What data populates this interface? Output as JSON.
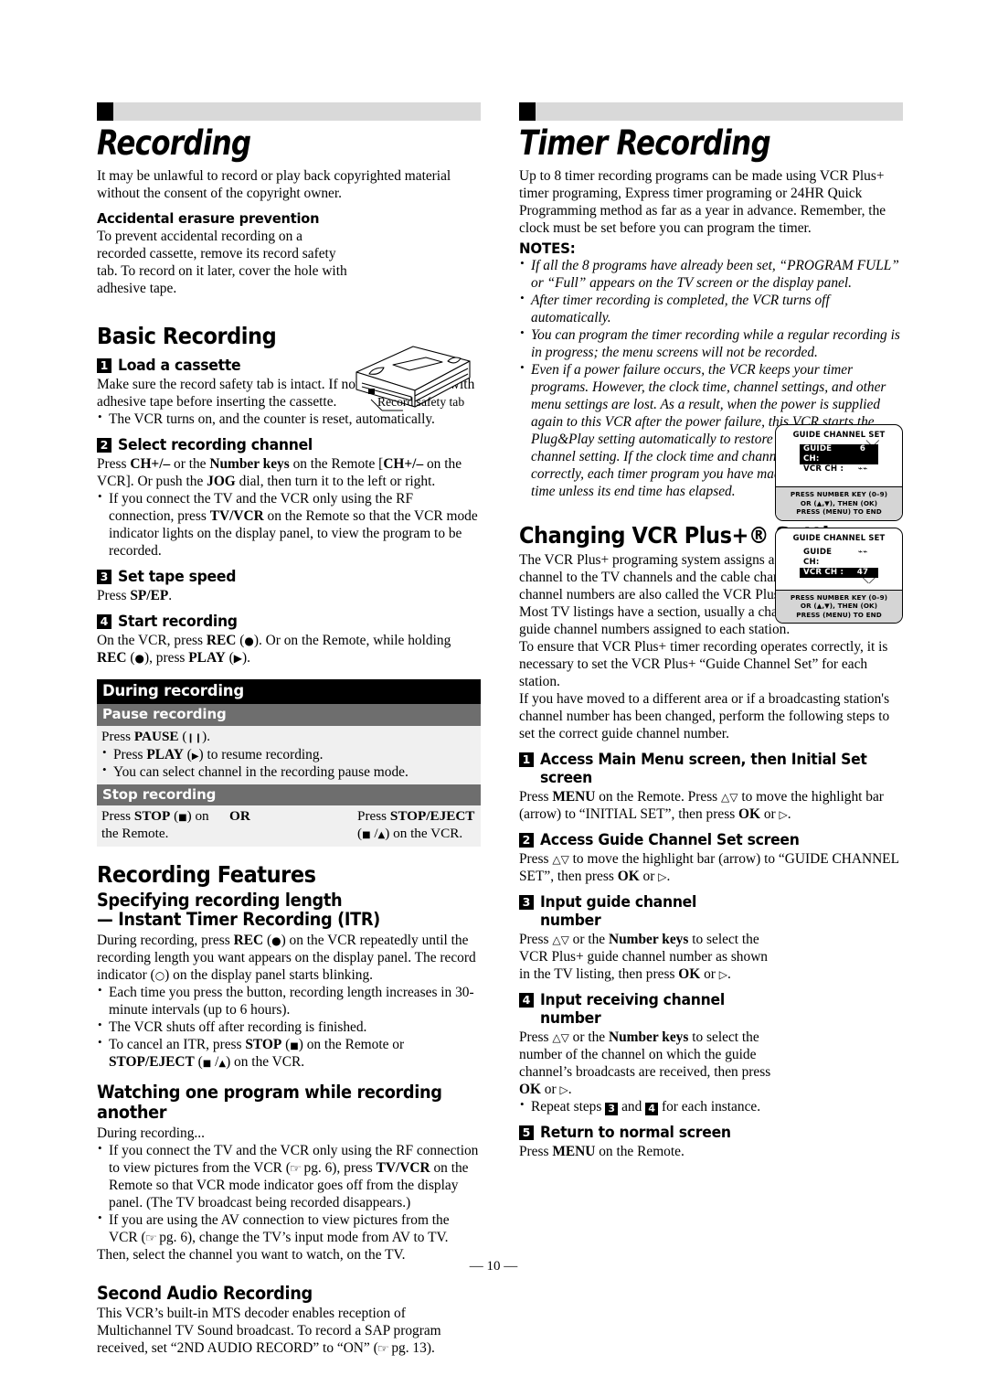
{
  "page": {
    "number": "— 10 —"
  },
  "left": {
    "chapter_title": "Recording",
    "intro": "It may be unlawful to record or play back copyrighted material without the consent of the copyright owner.",
    "accidental": {
      "heading": "Accidental erasure prevention",
      "body": "To prevent accidental recording on a recorded cassette, remove its record safety tab. To record on it later, cover the hole with adhesive tape.",
      "illustration_caption": "Record safety tab"
    },
    "basic_recording": {
      "heading": "Basic Recording",
      "steps": [
        {
          "num": "1",
          "title": "Load a cassette",
          "body": "Make sure the record safety tab is intact. If not, cover the hole with adhesive tape before inserting the cassette.",
          "bullets": [
            "The VCR turns on, and the counter is reset, automatically."
          ]
        },
        {
          "num": "2",
          "title": "Select recording channel",
          "body_pre": "Press ",
          "bullets": [
            "If you connect the TV and the VCR only using the RF connection, press TV/VCR on the Remote so that the VCR mode indicator lights on the display panel, to view the program to be recorded."
          ]
        },
        {
          "num": "3",
          "title": "Set tape speed",
          "body": "Press SP/EP."
        },
        {
          "num": "4",
          "title": "Start recording",
          "body": "On the VCR, press REC (●). Or on the Remote, while holding REC (●), press PLAY (▶)."
        }
      ]
    },
    "during_recording_table": {
      "header": "During recording",
      "pause_header": "Pause recording",
      "pause_line1": "Press PAUSE (❙❙).",
      "pause_bullets": [
        "Press PLAY (▶) to resume recording.",
        "You can select channel in the recording pause mode."
      ],
      "stop_header": "Stop recording",
      "stop_left": "Press STOP (■) on the Remote.",
      "or_label": "OR",
      "stop_right": "Press STOP/EJECT (■ / ▲) on the VCR."
    },
    "recording_features": {
      "heading": "Recording Features",
      "itr": {
        "heading_line1": "Specifying recording length",
        "heading_line2": "— Instant Timer Recording (ITR)",
        "body": "During recording, press REC (●) on the VCR repeatedly until the recording length you want appears on the display panel. The record indicator (○) on the display panel starts blinking.",
        "bullets": [
          "Each time you press the button, recording length increases in 30-minute intervals (up to 6 hours).",
          "The VCR shuts off after recording is finished.",
          "To cancel an ITR, press STOP (■) on the Remote or STOP/EJECT (■ / ▲) on the VCR."
        ]
      },
      "watching": {
        "heading": "Watching one program while recording another",
        "intro": "During recording...",
        "bullets": [
          "If you connect the TV and the VCR only using the RF connection to view pictures from the VCR (☞ pg. 6), press TV/VCR on the Remote so that VCR mode indicator goes off from the display panel. (The TV broadcast being recorded disappears.)",
          "If you are using the AV connection to view pictures from the VCR (☞ pg. 6), change the TV's input mode from AV to TV."
        ],
        "closing": "Then, select the channel you want to watch, on the TV."
      },
      "second_audio": {
        "heading": "Second Audio Recording",
        "body": "This VCR's built-in MTS decoder enables reception of Multichannel TV Sound broadcast. To record a SAP program received, set “2ND AUDIO RECORD” to “ON” (☞ pg. 13)."
      }
    }
  },
  "right": {
    "chapter_title": "Timer Recording",
    "intro": "Up to 8 timer recording programs can be made using VCR Plus+ timer programing, Express timer programing or 24HR Quick Programming method as far as a year in advance. Remember, the clock must be set before you can program the timer.",
    "notes_label": "NOTES:",
    "notes": [
      "If all the 8 programs have already been set, “PROGRAM FULL” or “Full” appears on the TV screen or the display panel.",
      "After timer recording is completed, the VCR turns off automatically.",
      "You can program the timer recording while a regular recording is in progress; the menu screens will not be recorded.",
      "Even if a power failure occurs, the VCR keeps your timer programs. However, the clock time, channel settings, and other menu settings are lost. As a result, when the power is supplied again to this VCR after the power failure, this VCR starts the Plug&Play setting automatically to restore the clock time and channel setting. If the clock time and channel setting are restored correctly, each timer program you have made will start at its start time unless its end time has elapsed."
    ],
    "vcrplus": {
      "heading": "Changing VCR Plus+® Setting",
      "para1": "The VCR Plus+ programing system assigns a VCR Plus+ guide channel to the TV channels and the cable channels. These guide channel numbers are also called the VCR Plus+ channel codes. Most TV listings have a section, usually a chart, indicating the guide channel numbers assigned to each station.",
      "para2": "To ensure that VCR Plus+ timer recording operates correctly, it is necessary to set the VCR Plus+ “Guide Channel Set” for each station.",
      "para3": "If you have moved to a different area or if a broadcasting station's channel number has been changed, perform the following steps to set the correct guide channel number.",
      "steps": [
        {
          "num": "1",
          "title": "Access Main Menu screen, then Initial Set screen",
          "body": "Press MENU on the Remote. Press △▽ to move the highlight bar (arrow) to “INITIAL SET”, then press OK or ▷."
        },
        {
          "num": "2",
          "title": "Access Guide Channel Set screen",
          "body": "Press △▽ to move the highlight bar (arrow) to “GUIDE CHANNEL SET”, then press OK or ▷."
        },
        {
          "num": "3",
          "title": "Input guide channel number",
          "body": "Press △▽ or the Number keys to select the VCR Plus+ guide channel number as shown in the TV listing, then press OK or ▷."
        },
        {
          "num": "4",
          "title": "Input receiving channel number",
          "body": "Press △▽ or the Number keys to select the number of the channel on which the guide channel's broadcasts are received, then press OK or ▷.",
          "bullet": "Repeat steps 3 and 4 for each instance."
        },
        {
          "num": "5",
          "title": "Return to normal screen",
          "body": "Press MENU on the Remote."
        }
      ]
    },
    "osd_screens": [
      {
        "title": "GUIDE CHANNEL SET",
        "row1_label": "GUIDE CH:",
        "row1_value": "6",
        "row1_highlighted": true,
        "row2_label": "VCR CH   :",
        "row2_value": "",
        "row2_highlighted": false,
        "footer_lines": [
          "PRESS NUMBER KEY (0–9)",
          "OR (▲,▼), THEN (OK)",
          "PRESS (MENU) TO END"
        ]
      },
      {
        "title": "GUIDE CHANNEL SET",
        "row1_label": "GUIDE CH:",
        "row1_value": "",
        "row1_highlighted": false,
        "row2_label": "VCR CH   :",
        "row2_value": "47",
        "row2_highlighted": true,
        "footer_lines": [
          "PRESS NUMBER KEY (0–9)",
          "OR (▲,▼), THEN (OK)",
          "PRESS (MENU) TO END"
        ]
      }
    ]
  },
  "colors": {
    "header_bar": "#d9d9d9",
    "table_header": "#000000",
    "table_subheader": "#6e6e6e",
    "table_body": "#f0f0f0",
    "osd_footer": "#d5d5d5"
  }
}
